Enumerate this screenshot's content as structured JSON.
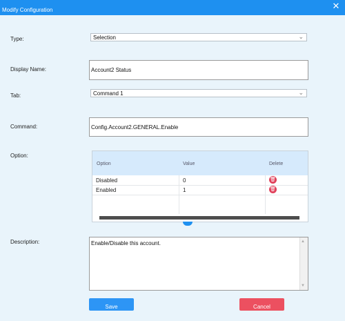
{
  "window": {
    "title": "Modify Configuration",
    "close_symbol": "✕"
  },
  "form": {
    "type": {
      "label": "Type:",
      "value": "Selection"
    },
    "display_name": {
      "label": "Display Name:",
      "value": "Account2 Status"
    },
    "tab": {
      "label": "Tab:",
      "value": "Command 1"
    },
    "command": {
      "label": "Command:",
      "value": "Config.Account2.GENERAL.Enable"
    },
    "option": {
      "label": "Option:",
      "columns": [
        "Option",
        "Value",
        "Delete"
      ],
      "rows": [
        {
          "option": "Disabled",
          "value": "0"
        },
        {
          "option": "Enabled",
          "value": "1"
        }
      ]
    },
    "description": {
      "label": "Description:",
      "value": "Enable/Disable this account."
    }
  },
  "buttons": {
    "save": "Save",
    "cancel": "Cancel"
  },
  "colors": {
    "title_bar": "#1e90f0",
    "background": "#e9f4fb",
    "save": "#2d95f5",
    "cancel": "#ec5060",
    "grid_header": "#d6eafc"
  },
  "icons": {
    "close": "close-icon",
    "dropdown": "chevron-down-icon",
    "delete": "trash-icon"
  }
}
